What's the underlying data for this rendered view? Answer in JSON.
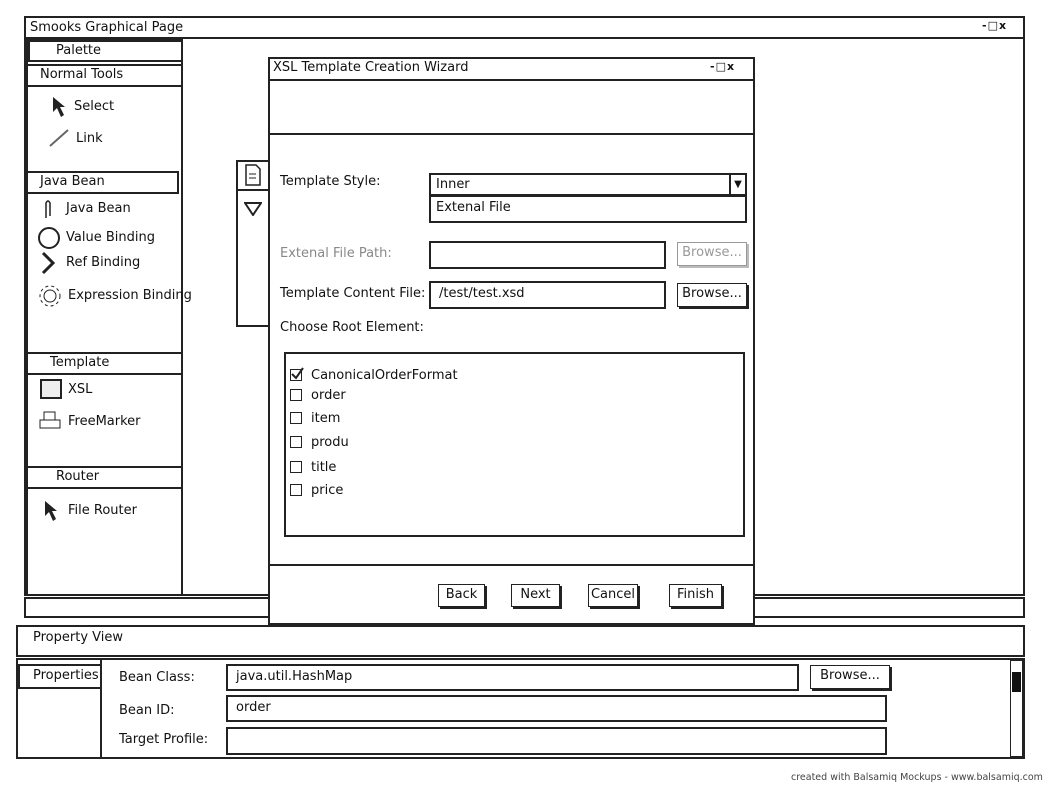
{
  "window": {
    "title": "Smooks Graphical Page",
    "controls": "-□x"
  },
  "palette": {
    "title": "Palette",
    "groups": [
      {
        "label": "Normal Tools",
        "items": [
          {
            "label": "Select",
            "icon": "arrow-cursor-icon"
          },
          {
            "label": "Link",
            "icon": "line-icon"
          }
        ]
      },
      {
        "label": "Java Bean",
        "items": [
          {
            "label": "Java Bean",
            "icon": "paperclip-icon"
          },
          {
            "label": "Value Binding",
            "icon": "circle-icon"
          },
          {
            "label": "Ref Binding",
            "icon": "chevron-right-icon"
          },
          {
            "label": "Expression Binding",
            "icon": "gear-icon"
          }
        ]
      },
      {
        "label": "Template",
        "items": [
          {
            "label": "XSL",
            "icon": "rss-icon"
          },
          {
            "label": "FreeMarker",
            "icon": "printer-icon"
          }
        ]
      },
      {
        "label": "Router",
        "items": [
          {
            "label": "File Router",
            "icon": "arrow-cursor-icon"
          }
        ]
      }
    ]
  },
  "property_view": {
    "title": "Property View",
    "tab": "Properties",
    "fields": [
      {
        "label": "Bean Class:",
        "value": "java.util.HashMap"
      },
      {
        "label": "Bean ID:",
        "value": "order"
      },
      {
        "label": "Target Profile:",
        "value": ""
      }
    ],
    "browse_label": "Browse..."
  },
  "dialog": {
    "title": "XSL Template Creation Wizard",
    "controls": "-□x",
    "template_style_label": "Template Style:",
    "template_style_value": "Inner",
    "template_style_options": [
      "Extenal File"
    ],
    "external_path_label": "Extenal File Path:",
    "external_path_value": "",
    "content_file_label": "Template Content File:",
    "content_file_value": "/test/test.xsd",
    "browse_label": "Browse...",
    "root_label": "Choose Root Element:",
    "root_items": [
      {
        "label": "CanonicalOrderFormat",
        "checked": true
      },
      {
        "label": "order",
        "checked": false
      },
      {
        "label": "item",
        "checked": false
      },
      {
        "label": "produ",
        "checked": false
      },
      {
        "label": "title",
        "checked": false
      },
      {
        "label": "price",
        "checked": false
      }
    ],
    "buttons": {
      "back": "Back",
      "next": "Next",
      "cancel": "Cancel",
      "finish": "Finish"
    }
  },
  "credit": "created with Balsamiq Mockups - www.balsamiq.com"
}
